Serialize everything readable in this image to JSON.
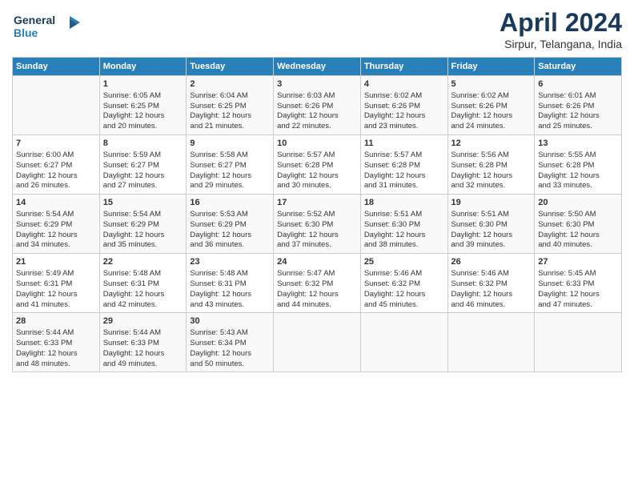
{
  "header": {
    "logo_line1": "General",
    "logo_line2": "Blue",
    "title": "April 2024",
    "subtitle": "Sirpur, Telangana, India"
  },
  "columns": [
    "Sunday",
    "Monday",
    "Tuesday",
    "Wednesday",
    "Thursday",
    "Friday",
    "Saturday"
  ],
  "weeks": [
    [
      {
        "day": "",
        "lines": []
      },
      {
        "day": "1",
        "lines": [
          "Sunrise: 6:05 AM",
          "Sunset: 6:25 PM",
          "Daylight: 12 hours",
          "and 20 minutes."
        ]
      },
      {
        "day": "2",
        "lines": [
          "Sunrise: 6:04 AM",
          "Sunset: 6:25 PM",
          "Daylight: 12 hours",
          "and 21 minutes."
        ]
      },
      {
        "day": "3",
        "lines": [
          "Sunrise: 6:03 AM",
          "Sunset: 6:26 PM",
          "Daylight: 12 hours",
          "and 22 minutes."
        ]
      },
      {
        "day": "4",
        "lines": [
          "Sunrise: 6:02 AM",
          "Sunset: 6:26 PM",
          "Daylight: 12 hours",
          "and 23 minutes."
        ]
      },
      {
        "day": "5",
        "lines": [
          "Sunrise: 6:02 AM",
          "Sunset: 6:26 PM",
          "Daylight: 12 hours",
          "and 24 minutes."
        ]
      },
      {
        "day": "6",
        "lines": [
          "Sunrise: 6:01 AM",
          "Sunset: 6:26 PM",
          "Daylight: 12 hours",
          "and 25 minutes."
        ]
      }
    ],
    [
      {
        "day": "7",
        "lines": [
          "Sunrise: 6:00 AM",
          "Sunset: 6:27 PM",
          "Daylight: 12 hours",
          "and 26 minutes."
        ]
      },
      {
        "day": "8",
        "lines": [
          "Sunrise: 5:59 AM",
          "Sunset: 6:27 PM",
          "Daylight: 12 hours",
          "and 27 minutes."
        ]
      },
      {
        "day": "9",
        "lines": [
          "Sunrise: 5:58 AM",
          "Sunset: 6:27 PM",
          "Daylight: 12 hours",
          "and 29 minutes."
        ]
      },
      {
        "day": "10",
        "lines": [
          "Sunrise: 5:57 AM",
          "Sunset: 6:28 PM",
          "Daylight: 12 hours",
          "and 30 minutes."
        ]
      },
      {
        "day": "11",
        "lines": [
          "Sunrise: 5:57 AM",
          "Sunset: 6:28 PM",
          "Daylight: 12 hours",
          "and 31 minutes."
        ]
      },
      {
        "day": "12",
        "lines": [
          "Sunrise: 5:56 AM",
          "Sunset: 6:28 PM",
          "Daylight: 12 hours",
          "and 32 minutes."
        ]
      },
      {
        "day": "13",
        "lines": [
          "Sunrise: 5:55 AM",
          "Sunset: 6:28 PM",
          "Daylight: 12 hours",
          "and 33 minutes."
        ]
      }
    ],
    [
      {
        "day": "14",
        "lines": [
          "Sunrise: 5:54 AM",
          "Sunset: 6:29 PM",
          "Daylight: 12 hours",
          "and 34 minutes."
        ]
      },
      {
        "day": "15",
        "lines": [
          "Sunrise: 5:54 AM",
          "Sunset: 6:29 PM",
          "Daylight: 12 hours",
          "and 35 minutes."
        ]
      },
      {
        "day": "16",
        "lines": [
          "Sunrise: 5:53 AM",
          "Sunset: 6:29 PM",
          "Daylight: 12 hours",
          "and 36 minutes."
        ]
      },
      {
        "day": "17",
        "lines": [
          "Sunrise: 5:52 AM",
          "Sunset: 6:30 PM",
          "Daylight: 12 hours",
          "and 37 minutes."
        ]
      },
      {
        "day": "18",
        "lines": [
          "Sunrise: 5:51 AM",
          "Sunset: 6:30 PM",
          "Daylight: 12 hours",
          "and 38 minutes."
        ]
      },
      {
        "day": "19",
        "lines": [
          "Sunrise: 5:51 AM",
          "Sunset: 6:30 PM",
          "Daylight: 12 hours",
          "and 39 minutes."
        ]
      },
      {
        "day": "20",
        "lines": [
          "Sunrise: 5:50 AM",
          "Sunset: 6:30 PM",
          "Daylight: 12 hours",
          "and 40 minutes."
        ]
      }
    ],
    [
      {
        "day": "21",
        "lines": [
          "Sunrise: 5:49 AM",
          "Sunset: 6:31 PM",
          "Daylight: 12 hours",
          "and 41 minutes."
        ]
      },
      {
        "day": "22",
        "lines": [
          "Sunrise: 5:48 AM",
          "Sunset: 6:31 PM",
          "Daylight: 12 hours",
          "and 42 minutes."
        ]
      },
      {
        "day": "23",
        "lines": [
          "Sunrise: 5:48 AM",
          "Sunset: 6:31 PM",
          "Daylight: 12 hours",
          "and 43 minutes."
        ]
      },
      {
        "day": "24",
        "lines": [
          "Sunrise: 5:47 AM",
          "Sunset: 6:32 PM",
          "Daylight: 12 hours",
          "and 44 minutes."
        ]
      },
      {
        "day": "25",
        "lines": [
          "Sunrise: 5:46 AM",
          "Sunset: 6:32 PM",
          "Daylight: 12 hours",
          "and 45 minutes."
        ]
      },
      {
        "day": "26",
        "lines": [
          "Sunrise: 5:46 AM",
          "Sunset: 6:32 PM",
          "Daylight: 12 hours",
          "and 46 minutes."
        ]
      },
      {
        "day": "27",
        "lines": [
          "Sunrise: 5:45 AM",
          "Sunset: 6:33 PM",
          "Daylight: 12 hours",
          "and 47 minutes."
        ]
      }
    ],
    [
      {
        "day": "28",
        "lines": [
          "Sunrise: 5:44 AM",
          "Sunset: 6:33 PM",
          "Daylight: 12 hours",
          "and 48 minutes."
        ]
      },
      {
        "day": "29",
        "lines": [
          "Sunrise: 5:44 AM",
          "Sunset: 6:33 PM",
          "Daylight: 12 hours",
          "and 49 minutes."
        ]
      },
      {
        "day": "30",
        "lines": [
          "Sunrise: 5:43 AM",
          "Sunset: 6:34 PM",
          "Daylight: 12 hours",
          "and 50 minutes."
        ]
      },
      {
        "day": "",
        "lines": []
      },
      {
        "day": "",
        "lines": []
      },
      {
        "day": "",
        "lines": []
      },
      {
        "day": "",
        "lines": []
      }
    ]
  ]
}
